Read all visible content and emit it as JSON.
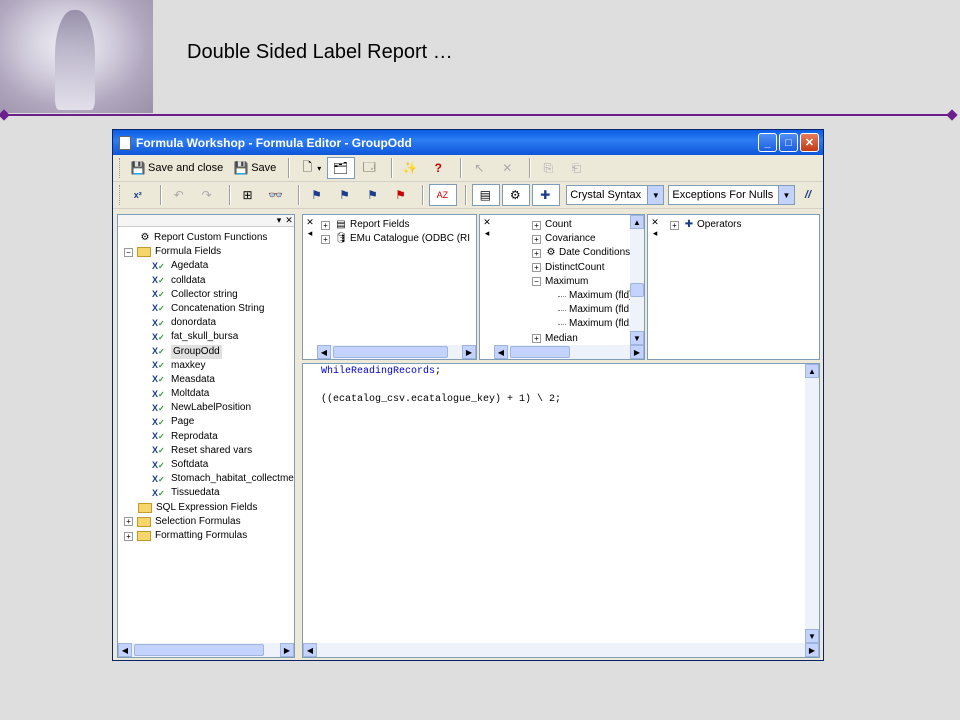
{
  "slide": {
    "title": "Double Sided Label Report …"
  },
  "window": {
    "title": "Formula Workshop - Formula Editor - GroupOdd",
    "controls": {
      "minimize": "_",
      "maximize": "□",
      "close": "✕"
    }
  },
  "toolbar1": {
    "save_and_close": "Save and close",
    "save": "Save"
  },
  "toolbar2": {
    "syntax_select": "Crystal Syntax",
    "null_select": "Exceptions For Nulls",
    "comment_button": "//"
  },
  "workshop_tree": {
    "top": "Report Custom Functions",
    "formula_fields_label": "Formula Fields",
    "formula_fields": [
      "Agedata",
      "colldata",
      "Collector string",
      "Concatenation String",
      "donordata",
      "fat_skull_bursa",
      "GroupOdd",
      "maxkey",
      "Measdata",
      "Moltdata",
      "NewLabelPosition",
      "Page",
      "Reprodata",
      "Reset shared vars",
      "Softdata",
      "Stomach_habitat_collectme",
      "Tissuedata"
    ],
    "others": [
      "SQL Expression Fields",
      "Selection Formulas",
      "Formatting Formulas"
    ]
  },
  "fields_tree": [
    "Report Fields",
    "EMu Catalogue (ODBC (RI"
  ],
  "functions_tree": [
    "Count",
    "Covariance",
    "Date Conditions",
    "DistinctCount",
    "Maximum",
    "Maximum (fld)",
    "Maximum (fld, c",
    "Maximum (fld, c",
    "Median"
  ],
  "operators_tree": [
    "Operators"
  ],
  "formula_text": {
    "line1_keyword": "WhileReadingRecords",
    "line1_end": ";",
    "line2": "((ecatalog_csv.ecatalogue_key) + 1) \\ 2;"
  },
  "colors": {
    "purple_rule": "#6a1f8a",
    "xp_blue": "#0a5ce3"
  }
}
